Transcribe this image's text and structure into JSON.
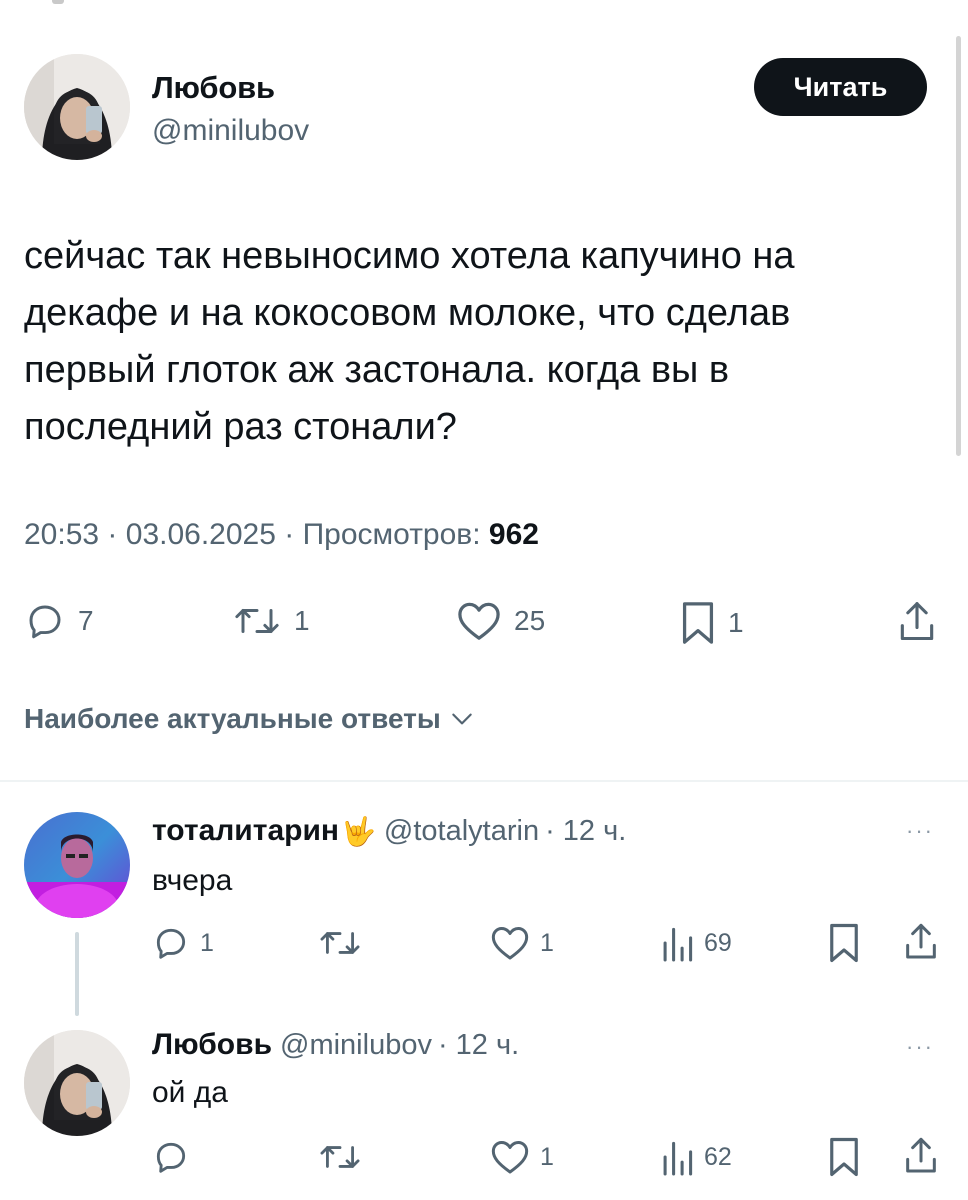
{
  "tweet": {
    "author_name": "Любовь",
    "author_handle": "@minilubov",
    "follow_label": "Читать",
    "text": "сейчас так невыносимо хотела капучино на декафе и на кокосовом молоке, что сделав первый глоток аж застонала. когда вы в последний раз стонали?",
    "time": "20:53",
    "date": "03.06.2025",
    "views_label": "Просмотров:",
    "views_count": "962",
    "separator": "·",
    "stats": {
      "replies": "7",
      "retweets": "1",
      "likes": "25",
      "bookmarks": "1"
    }
  },
  "replies_sort_label": "Наиболее актуальные ответы",
  "replies": [
    {
      "name": "тоталитарин",
      "emoji": "🤟",
      "handle": "@totalytarin",
      "time": "· 12 ч.",
      "text": "вчера",
      "more": "···",
      "stats": {
        "replies": "1",
        "retweets": "",
        "likes": "1",
        "views": "69"
      }
    },
    {
      "name": "Любовь",
      "handle": "@minilubov",
      "time": "· 12 ч.",
      "text": "ой да",
      "more": "···",
      "stats": {
        "replies": "",
        "retweets": "",
        "likes": "1",
        "views": "62"
      }
    }
  ],
  "colors": {
    "text": "#0f1419",
    "secondary": "#536471",
    "button_bg": "#0f1419",
    "divider": "#eff3f4"
  },
  "icons": [
    "reply-icon",
    "retweet-icon",
    "like-icon",
    "bookmark-icon",
    "share-icon",
    "views-icon",
    "chevron-down-icon",
    "more-icon"
  ]
}
